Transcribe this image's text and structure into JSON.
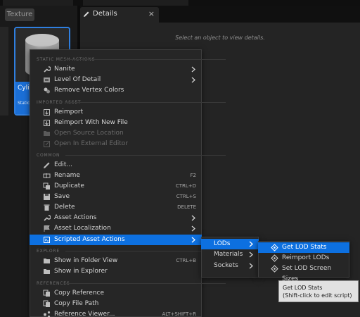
{
  "colors": {
    "highlight": "#0d70e0",
    "menu_bg": "#262626",
    "panel_bg": "#242424",
    "selection_border": "#2f7fe0"
  },
  "content_browser": {
    "filter_chip": "Texture",
    "asset": {
      "name": "Cylin",
      "type_hint": "Static"
    }
  },
  "details_panel": {
    "tab_label": "Details",
    "tab_icon": "pencil-icon",
    "close_label": "×",
    "empty_message": "Select an object to view details."
  },
  "context_menu": {
    "sections": [
      {
        "title": "STATIC MESH ACTIONS"
      },
      {
        "title": "IMPORTED ASSET"
      },
      {
        "title": "COMMON"
      },
      {
        "title": "EXPLORE"
      },
      {
        "title": "REFERENCES"
      }
    ],
    "items": [
      {
        "label": "Nanite",
        "icon": "wrench-icon",
        "submenu": true,
        "shortcut": ""
      },
      {
        "label": "Level Of Detail",
        "icon": "lod-icon",
        "submenu": true,
        "shortcut": ""
      },
      {
        "label": "Remove Vertex Colors",
        "icon": "paint-icon",
        "submenu": false,
        "shortcut": ""
      },
      {
        "label": "Reimport",
        "icon": "reimport-icon",
        "submenu": false,
        "shortcut": ""
      },
      {
        "label": "Reimport With New File",
        "icon": "reimport-file-icon",
        "submenu": false,
        "shortcut": ""
      },
      {
        "label": "Open Source Location",
        "icon": "folder-icon",
        "submenu": false,
        "shortcut": "",
        "disabled": true
      },
      {
        "label": "Open In External Editor",
        "icon": "external-icon",
        "submenu": false,
        "shortcut": "",
        "disabled": true
      },
      {
        "label": "Edit...",
        "icon": "pencil-icon",
        "submenu": false,
        "shortcut": ""
      },
      {
        "label": "Rename",
        "icon": "rename-icon",
        "submenu": false,
        "shortcut": "F2"
      },
      {
        "label": "Duplicate",
        "icon": "duplicate-icon",
        "submenu": false,
        "shortcut": "CTRL+D"
      },
      {
        "label": "Save",
        "icon": "save-icon",
        "submenu": false,
        "shortcut": "CTRL+S"
      },
      {
        "label": "Delete",
        "icon": "trash-icon",
        "submenu": false,
        "shortcut": "DELETE"
      },
      {
        "label": "Asset Actions",
        "icon": "wrench-icon",
        "submenu": true,
        "shortcut": ""
      },
      {
        "label": "Asset Localization",
        "icon": "flag-icon",
        "submenu": true,
        "shortcut": ""
      },
      {
        "label": "Scripted Asset Actions",
        "icon": "script-icon",
        "submenu": true,
        "shortcut": "",
        "highlighted": true
      },
      {
        "label": "Show in Folder View",
        "icon": "folder-view-icon",
        "submenu": false,
        "shortcut": "CTRL+B"
      },
      {
        "label": "Show in Explorer",
        "icon": "explorer-icon",
        "submenu": false,
        "shortcut": ""
      },
      {
        "label": "Copy Reference",
        "icon": "copy-icon",
        "submenu": false,
        "shortcut": ""
      },
      {
        "label": "Copy File Path",
        "icon": "copy-path-icon",
        "submenu": false,
        "shortcut": ""
      },
      {
        "label": "Reference Viewer...",
        "icon": "reference-viewer-icon",
        "submenu": false,
        "shortcut": "ALT+SHIFT+R"
      }
    ]
  },
  "scripted_submenu": {
    "items": [
      {
        "label": "LODs",
        "highlighted": true
      },
      {
        "label": "Materials",
        "highlighted": false
      },
      {
        "label": "Sockets",
        "highlighted": false
      }
    ]
  },
  "lods_submenu": {
    "items": [
      {
        "label": "Get LOD Stats",
        "icon": "action-diamond-icon",
        "highlighted": true
      },
      {
        "label": "Reimport LODs",
        "icon": "action-diamond-icon",
        "highlighted": false
      },
      {
        "label": "Set LOD Screen Sizes",
        "icon": "action-diamond-icon",
        "highlighted": false
      }
    ]
  },
  "tooltip": {
    "line1": "Get LOD Stats",
    "line2": "(Shift-click to edit script)"
  }
}
